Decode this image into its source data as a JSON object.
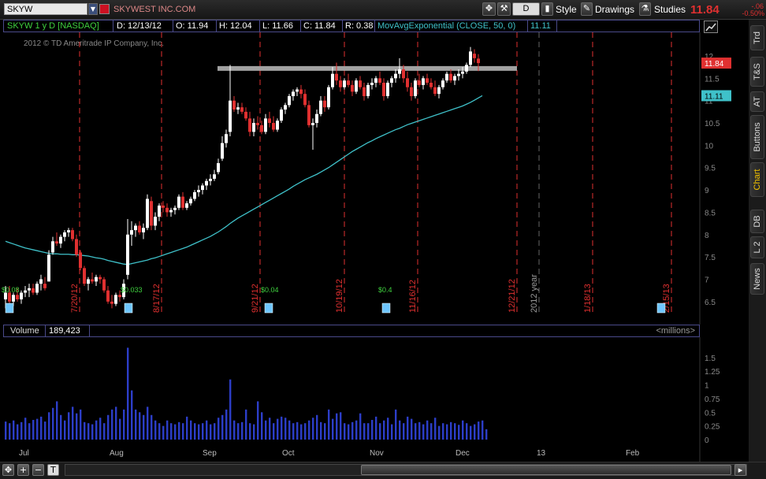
{
  "toolbar": {
    "symbol": "SKYW",
    "company": "SKYWEST INC.COM",
    "aggregation": "D",
    "style_label": "Style",
    "drawings_label": "Drawings",
    "studies_label": "Studies",
    "last_price": "11.84",
    "change": "-.06",
    "change_pct": "-0.50%"
  },
  "infobar": {
    "title": "SKYW 1 y D [NASDAQ]",
    "date": "D: 12/13/12",
    "open": "O: 11.94",
    "high": "H: 12.04",
    "low": "L: 11.66",
    "close": "C: 11.84",
    "range": "R: 0.38",
    "study": "MovAvgExponential (CLOSE, 50, 0)",
    "study_value": "11.11"
  },
  "copyright": "2012 © TD Ameritrade IP Company, Inc.",
  "sidebar_tabs": [
    "Trd",
    "T&S",
    "AT",
    "Buttons",
    "Chart",
    "DB",
    "L 2",
    "News"
  ],
  "active_tab": "Chart",
  "volume": {
    "label": "Volume",
    "value": "189,423",
    "units": "<millions>"
  },
  "colors": {
    "up_candle": "#ffffff",
    "down_candle": "#e03030",
    "ema_line": "#3fc1c9",
    "event_line": "#e03030",
    "volume_bar": "#2c3ec8",
    "resistance": "#bdbdbd",
    "price_axis": "#888888"
  },
  "chart_data": {
    "type": "candlestick",
    "price_axis_ticks": [
      "12",
      "11.5",
      "11",
      "10.5",
      "10",
      "9.5",
      "9",
      "8.5",
      "8",
      "7.5",
      "7",
      "6.5"
    ],
    "price_ylim": [
      6.25,
      12.3
    ],
    "price_labels": {
      "last": "11.84",
      "ema": "11.11"
    },
    "time_labels": [
      "Jul",
      "Aug",
      "Sep",
      "Oct",
      "Nov",
      "Dec",
      "13",
      "Feb"
    ],
    "event_labels": [
      "7/20/12",
      "8/17/12",
      "9/21/12",
      "10/19/12",
      "11/16/12",
      "12/21/12",
      "2012 year",
      "1/18/13",
      "2/15/13"
    ],
    "dividends": [
      "$0.08",
      "$0.033",
      "$0.04",
      "$0.4"
    ],
    "resistance_level": 11.72,
    "volume_axis_ticks": [
      "1.5",
      "1.25",
      "1",
      "0.75",
      "0.5",
      "0.25",
      "0"
    ],
    "volume_ylim": [
      0,
      1.7
    ],
    "candles": [
      {
        "o": 6.55,
        "h": 6.85,
        "l": 6.35,
        "c": 6.7
      },
      {
        "o": 6.7,
        "h": 6.85,
        "l": 6.45,
        "c": 6.5
      },
      {
        "o": 6.5,
        "h": 6.7,
        "l": 6.4,
        "c": 6.65
      },
      {
        "o": 6.65,
        "h": 6.8,
        "l": 6.5,
        "c": 6.55
      },
      {
        "o": 6.55,
        "h": 6.75,
        "l": 6.45,
        "c": 6.7
      },
      {
        "o": 6.7,
        "h": 6.85,
        "l": 6.6,
        "c": 6.75
      },
      {
        "o": 6.75,
        "h": 6.9,
        "l": 6.6,
        "c": 6.8
      },
      {
        "o": 6.8,
        "h": 6.9,
        "l": 6.65,
        "c": 6.7
      },
      {
        "o": 6.7,
        "h": 6.95,
        "l": 6.65,
        "c": 6.9
      },
      {
        "o": 6.9,
        "h": 7.1,
        "l": 6.75,
        "c": 7.0
      },
      {
        "o": 6.9,
        "h": 7.05,
        "l": 6.75,
        "c": 6.8
      },
      {
        "o": 6.95,
        "h": 7.65,
        "l": 6.95,
        "c": 7.55
      },
      {
        "o": 7.6,
        "h": 7.95,
        "l": 7.55,
        "c": 7.85
      },
      {
        "o": 7.85,
        "h": 8.05,
        "l": 7.75,
        "c": 7.8
      },
      {
        "o": 7.8,
        "h": 8.0,
        "l": 7.7,
        "c": 7.95
      },
      {
        "o": 7.95,
        "h": 8.1,
        "l": 7.85,
        "c": 8.05
      },
      {
        "o": 8.05,
        "h": 8.15,
        "l": 7.95,
        "c": 8.1
      },
      {
        "o": 8.1,
        "h": 8.15,
        "l": 7.85,
        "c": 7.9
      },
      {
        "o": 7.9,
        "h": 8.0,
        "l": 7.5,
        "c": 7.55
      },
      {
        "o": 7.6,
        "h": 7.65,
        "l": 7.2,
        "c": 7.25
      },
      {
        "o": 7.25,
        "h": 7.3,
        "l": 6.85,
        "c": 6.9
      },
      {
        "o": 6.9,
        "h": 7.05,
        "l": 6.75,
        "c": 7.0
      },
      {
        "o": 7.0,
        "h": 7.15,
        "l": 6.9,
        "c": 6.95
      },
      {
        "o": 6.95,
        "h": 7.1,
        "l": 6.85,
        "c": 7.05
      },
      {
        "o": 7.05,
        "h": 7.1,
        "l": 6.9,
        "c": 7.0
      },
      {
        "o": 7.0,
        "h": 7.05,
        "l": 6.7,
        "c": 6.75
      },
      {
        "o": 6.75,
        "h": 6.85,
        "l": 6.45,
        "c": 6.5
      },
      {
        "o": 6.5,
        "h": 6.65,
        "l": 6.35,
        "c": 6.45
      },
      {
        "o": 6.45,
        "h": 6.7,
        "l": 6.4,
        "c": 6.65
      },
      {
        "o": 6.65,
        "h": 6.75,
        "l": 6.5,
        "c": 6.6
      },
      {
        "o": 6.6,
        "h": 7.0,
        "l": 6.55,
        "c": 6.9
      },
      {
        "o": 7.1,
        "h": 8.35,
        "l": 7.0,
        "c": 8.0
      },
      {
        "o": 8.0,
        "h": 8.3,
        "l": 7.75,
        "c": 8.1
      },
      {
        "o": 8.1,
        "h": 8.25,
        "l": 7.95,
        "c": 8.2
      },
      {
        "o": 8.2,
        "h": 8.3,
        "l": 8.0,
        "c": 8.05
      },
      {
        "o": 8.05,
        "h": 8.25,
        "l": 7.9,
        "c": 8.15
      },
      {
        "o": 8.15,
        "h": 8.9,
        "l": 8.1,
        "c": 8.8
      },
      {
        "o": 8.75,
        "h": 8.85,
        "l": 8.1,
        "c": 8.2
      },
      {
        "o": 8.2,
        "h": 8.5,
        "l": 8.1,
        "c": 8.4
      },
      {
        "o": 8.4,
        "h": 8.7,
        "l": 8.3,
        "c": 8.65
      },
      {
        "o": 8.65,
        "h": 8.75,
        "l": 8.5,
        "c": 8.6
      },
      {
        "o": 8.6,
        "h": 8.7,
        "l": 8.4,
        "c": 8.5
      },
      {
        "o": 8.5,
        "h": 8.6,
        "l": 8.4,
        "c": 8.55
      },
      {
        "o": 8.55,
        "h": 8.65,
        "l": 8.45,
        "c": 8.6
      },
      {
        "o": 8.6,
        "h": 8.9,
        "l": 8.55,
        "c": 8.85
      },
      {
        "o": 8.85,
        "h": 8.95,
        "l": 8.55,
        "c": 8.6
      },
      {
        "o": 8.6,
        "h": 8.75,
        "l": 8.55,
        "c": 8.7
      },
      {
        "o": 8.7,
        "h": 8.85,
        "l": 8.65,
        "c": 8.8
      },
      {
        "o": 8.8,
        "h": 9.0,
        "l": 8.75,
        "c": 8.95
      },
      {
        "o": 8.95,
        "h": 9.1,
        "l": 8.85,
        "c": 9.0
      },
      {
        "o": 9.0,
        "h": 9.15,
        "l": 8.9,
        "c": 9.1
      },
      {
        "o": 9.1,
        "h": 9.25,
        "l": 9.0,
        "c": 9.2
      },
      {
        "o": 9.2,
        "h": 9.35,
        "l": 9.1,
        "c": 9.25
      },
      {
        "o": 9.25,
        "h": 9.45,
        "l": 9.2,
        "c": 9.35
      },
      {
        "o": 9.4,
        "h": 9.7,
        "l": 9.35,
        "c": 9.6
      },
      {
        "o": 9.7,
        "h": 10.2,
        "l": 9.65,
        "c": 10.05
      },
      {
        "o": 10.05,
        "h": 10.35,
        "l": 9.95,
        "c": 10.25
      },
      {
        "o": 10.3,
        "h": 11.8,
        "l": 10.2,
        "c": 11.0
      },
      {
        "o": 11.0,
        "h": 11.1,
        "l": 10.75,
        "c": 10.8
      },
      {
        "o": 10.8,
        "h": 10.95,
        "l": 10.7,
        "c": 10.85
      },
      {
        "o": 10.85,
        "h": 10.95,
        "l": 10.7,
        "c": 10.75
      },
      {
        "o": 10.75,
        "h": 10.85,
        "l": 10.55,
        "c": 10.6
      },
      {
        "o": 10.6,
        "h": 10.75,
        "l": 10.2,
        "c": 10.3
      },
      {
        "o": 10.3,
        "h": 10.6,
        "l": 10.2,
        "c": 10.5
      },
      {
        "o": 10.5,
        "h": 10.65,
        "l": 10.35,
        "c": 10.45
      },
      {
        "o": 10.45,
        "h": 10.55,
        "l": 10.25,
        "c": 10.3
      },
      {
        "o": 10.3,
        "h": 10.7,
        "l": 10.25,
        "c": 10.6
      },
      {
        "o": 10.6,
        "h": 10.75,
        "l": 10.4,
        "c": 10.5
      },
      {
        "o": 10.5,
        "h": 10.65,
        "l": 10.3,
        "c": 10.35
      },
      {
        "o": 10.35,
        "h": 10.6,
        "l": 10.3,
        "c": 10.55
      },
      {
        "o": 10.55,
        "h": 10.85,
        "l": 10.5,
        "c": 10.8
      },
      {
        "o": 10.8,
        "h": 10.95,
        "l": 10.7,
        "c": 10.9
      },
      {
        "o": 10.9,
        "h": 11.15,
        "l": 10.85,
        "c": 11.1
      },
      {
        "o": 11.1,
        "h": 11.25,
        "l": 11.0,
        "c": 11.2
      },
      {
        "o": 11.2,
        "h": 11.3,
        "l": 11.1,
        "c": 11.25
      },
      {
        "o": 11.25,
        "h": 11.35,
        "l": 11.05,
        "c": 11.15
      },
      {
        "o": 11.15,
        "h": 11.25,
        "l": 10.85,
        "c": 10.9
      },
      {
        "o": 10.9,
        "h": 11.0,
        "l": 10.4,
        "c": 10.45
      },
      {
        "o": 10.45,
        "h": 10.6,
        "l": 9.9,
        "c": 10.5
      },
      {
        "o": 10.5,
        "h": 10.8,
        "l": 10.4,
        "c": 10.7
      },
      {
        "o": 10.7,
        "h": 11.1,
        "l": 10.65,
        "c": 11.0
      },
      {
        "o": 11.0,
        "h": 11.1,
        "l": 10.75,
        "c": 10.85
      },
      {
        "o": 10.85,
        "h": 11.35,
        "l": 10.8,
        "c": 11.3
      },
      {
        "o": 11.3,
        "h": 11.75,
        "l": 11.25,
        "c": 11.6
      },
      {
        "o": 11.6,
        "h": 11.85,
        "l": 11.35,
        "c": 11.45
      },
      {
        "o": 11.45,
        "h": 11.55,
        "l": 11.2,
        "c": 11.3
      },
      {
        "o": 11.3,
        "h": 11.5,
        "l": 11.25,
        "c": 11.45
      },
      {
        "o": 11.45,
        "h": 11.6,
        "l": 11.3,
        "c": 11.35
      },
      {
        "o": 11.35,
        "h": 11.45,
        "l": 11.1,
        "c": 11.2
      },
      {
        "o": 11.2,
        "h": 11.5,
        "l": 11.15,
        "c": 11.45
      },
      {
        "o": 11.45,
        "h": 11.55,
        "l": 11.25,
        "c": 11.3
      },
      {
        "o": 11.3,
        "h": 11.4,
        "l": 11.0,
        "c": 11.1
      },
      {
        "o": 11.1,
        "h": 11.4,
        "l": 11.05,
        "c": 11.35
      },
      {
        "o": 11.35,
        "h": 11.5,
        "l": 11.25,
        "c": 11.4
      },
      {
        "o": 11.4,
        "h": 11.55,
        "l": 11.3,
        "c": 11.5
      },
      {
        "o": 11.5,
        "h": 11.65,
        "l": 11.35,
        "c": 11.4
      },
      {
        "o": 11.4,
        "h": 11.5,
        "l": 11.0,
        "c": 11.1
      },
      {
        "o": 11.1,
        "h": 11.45,
        "l": 11.05,
        "c": 11.4
      },
      {
        "o": 11.4,
        "h": 11.55,
        "l": 11.3,
        "c": 11.5
      },
      {
        "o": 11.5,
        "h": 11.7,
        "l": 11.4,
        "c": 11.6
      },
      {
        "o": 11.6,
        "h": 11.95,
        "l": 11.5,
        "c": 11.7
      },
      {
        "o": 11.7,
        "h": 11.8,
        "l": 11.4,
        "c": 11.5
      },
      {
        "o": 11.5,
        "h": 11.65,
        "l": 11.2,
        "c": 11.3
      },
      {
        "o": 11.3,
        "h": 11.4,
        "l": 11.0,
        "c": 11.1
      },
      {
        "o": 11.1,
        "h": 11.5,
        "l": 11.05,
        "c": 11.45
      },
      {
        "o": 11.45,
        "h": 11.6,
        "l": 11.3,
        "c": 11.35
      },
      {
        "o": 11.35,
        "h": 11.55,
        "l": 11.25,
        "c": 11.5
      },
      {
        "o": 11.5,
        "h": 11.6,
        "l": 11.35,
        "c": 11.4
      },
      {
        "o": 11.4,
        "h": 11.5,
        "l": 11.25,
        "c": 11.3
      },
      {
        "o": 11.3,
        "h": 11.45,
        "l": 11.1,
        "c": 11.15
      },
      {
        "o": 11.15,
        "h": 11.35,
        "l": 11.05,
        "c": 11.3
      },
      {
        "o": 11.3,
        "h": 11.5,
        "l": 11.25,
        "c": 11.45
      },
      {
        "o": 11.45,
        "h": 11.65,
        "l": 11.4,
        "c": 11.6
      },
      {
        "o": 11.6,
        "h": 11.7,
        "l": 11.4,
        "c": 11.45
      },
      {
        "o": 11.45,
        "h": 11.6,
        "l": 11.35,
        "c": 11.55
      },
      {
        "o": 11.55,
        "h": 11.7,
        "l": 11.45,
        "c": 11.6
      },
      {
        "o": 11.6,
        "h": 11.75,
        "l": 11.5,
        "c": 11.65
      },
      {
        "o": 11.65,
        "h": 11.85,
        "l": 11.6,
        "c": 11.8
      },
      {
        "o": 11.8,
        "h": 12.2,
        "l": 11.75,
        "c": 12.1
      },
      {
        "o": 12.05,
        "h": 12.15,
        "l": 11.85,
        "c": 11.95
      },
      {
        "o": 11.94,
        "h": 12.04,
        "l": 11.66,
        "c": 11.84
      }
    ],
    "ema50": [
      7.85,
      7.82,
      7.79,
      7.76,
      7.73,
      7.7,
      7.68,
      7.66,
      7.64,
      7.62,
      7.6,
      7.58,
      7.57,
      7.57,
      7.56,
      7.56,
      7.56,
      7.55,
      7.55,
      7.54,
      7.53,
      7.52,
      7.5,
      7.48,
      7.47,
      7.45,
      7.42,
      7.4,
      7.38,
      7.36,
      7.34,
      7.33,
      7.35,
      7.37,
      7.39,
      7.41,
      7.43,
      7.46,
      7.48,
      7.51,
      7.54,
      7.57,
      7.6,
      7.63,
      7.66,
      7.69,
      7.72,
      7.76,
      7.8,
      7.84,
      7.88,
      7.92,
      7.96,
      8.01,
      8.06,
      8.12,
      8.18,
      8.25,
      8.31,
      8.37,
      8.42,
      8.47,
      8.52,
      8.57,
      8.62,
      8.67,
      8.72,
      8.77,
      8.82,
      8.87,
      8.92,
      8.97,
      9.02,
      9.08,
      9.13,
      9.18,
      9.23,
      9.27,
      9.31,
      9.35,
      9.4,
      9.45,
      9.5,
      9.56,
      9.62,
      9.68,
      9.74,
      9.8,
      9.86,
      9.91,
      9.96,
      10.01,
      10.06,
      10.1,
      10.15,
      10.19,
      10.23,
      10.27,
      10.31,
      10.35,
      10.38,
      10.42,
      10.46,
      10.49,
      10.52,
      10.55,
      10.58,
      10.61,
      10.64,
      10.67,
      10.7,
      10.73,
      10.76,
      10.79,
      10.82,
      10.85,
      10.88,
      10.92,
      10.96,
      11.01,
      11.06,
      11.11
    ],
    "volumes": [
      0.33,
      0.3,
      0.35,
      0.28,
      0.32,
      0.4,
      0.3,
      0.36,
      0.38,
      0.42,
      0.33,
      0.5,
      0.58,
      0.7,
      0.45,
      0.35,
      0.5,
      0.6,
      0.48,
      0.55,
      0.32,
      0.3,
      0.28,
      0.35,
      0.4,
      0.3,
      0.45,
      0.55,
      0.6,
      0.38,
      0.55,
      1.68,
      0.9,
      0.55,
      0.5,
      0.45,
      0.6,
      0.45,
      0.35,
      0.3,
      0.25,
      0.35,
      0.3,
      0.28,
      0.32,
      0.3,
      0.42,
      0.35,
      0.3,
      0.28,
      0.3,
      0.35,
      0.28,
      0.3,
      0.4,
      0.45,
      0.55,
      1.1,
      0.35,
      0.3,
      0.32,
      0.55,
      0.3,
      0.28,
      0.7,
      0.5,
      0.35,
      0.4,
      0.3,
      0.38,
      0.42,
      0.4,
      0.35,
      0.3,
      0.32,
      0.28,
      0.3,
      0.35,
      0.4,
      0.45,
      0.32,
      0.3,
      0.55,
      0.38,
      0.48,
      0.5,
      0.3,
      0.28,
      0.32,
      0.35,
      0.48,
      0.3,
      0.3,
      0.36,
      0.42,
      0.3,
      0.35,
      0.4,
      0.28,
      0.55,
      0.35,
      0.3,
      0.42,
      0.38,
      0.3,
      0.32,
      0.28,
      0.35,
      0.3,
      0.4,
      0.25,
      0.3,
      0.28,
      0.32,
      0.3,
      0.27,
      0.35,
      0.3,
      0.25,
      0.28,
      0.33,
      0.35,
      0.19
    ]
  }
}
